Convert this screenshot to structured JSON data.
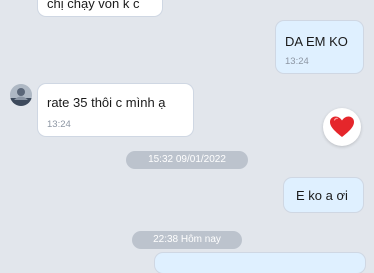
{
  "chat": {
    "messages": [
      {
        "direction": "incoming",
        "text": "chị chạy von k c",
        "time": ""
      },
      {
        "direction": "outgoing",
        "text": "DA EM KO",
        "time": "13:24"
      },
      {
        "direction": "incoming",
        "text": "rate 35 thôi c mình ạ",
        "time": "13:24",
        "reaction": "heart-icon"
      },
      {
        "direction": "outgoing",
        "text": "E ko a ơi",
        "time": ""
      }
    ],
    "dividers": [
      {
        "label": "15:32 09/01/2022"
      },
      {
        "label": "22:38 Hôm nay"
      }
    ]
  },
  "colors": {
    "background": "#e2e6ec",
    "incoming_bubble": "#ffffff",
    "outgoing_bubble": "#dff0ff",
    "divider_pill": "#bcc3cd",
    "heart": "#e5262b"
  }
}
